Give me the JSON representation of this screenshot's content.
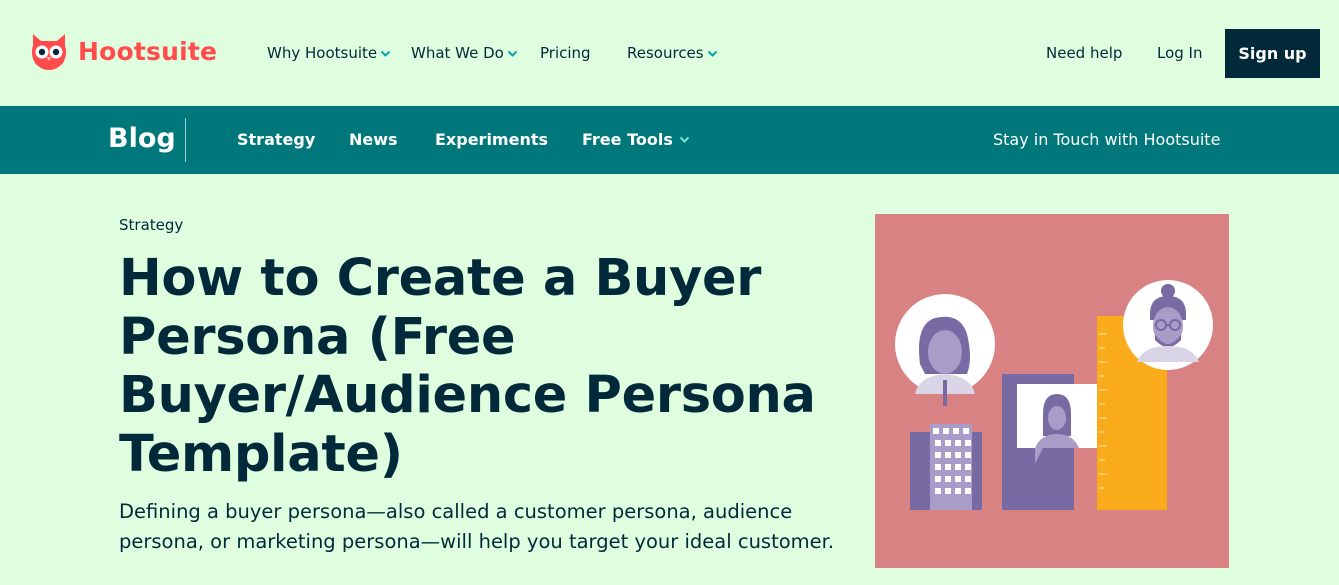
{
  "brand": {
    "name": "Hootsuite",
    "accent": "#ff4b4b",
    "dark": "#012939",
    "teal": "#00777a",
    "background": "#dffee0"
  },
  "topnav": {
    "items": [
      {
        "label": "Why Hootsuite",
        "has_dropdown": true
      },
      {
        "label": "What We Do",
        "has_dropdown": true
      },
      {
        "label": "Pricing",
        "has_dropdown": false
      },
      {
        "label": "Resources",
        "has_dropdown": true
      }
    ],
    "help": "Need help",
    "login": "Log In",
    "signup": "Sign up"
  },
  "blogbar": {
    "title": "Blog",
    "items": [
      {
        "label": "Strategy"
      },
      {
        "label": "News"
      },
      {
        "label": "Experiments"
      },
      {
        "label": "Free Tools",
        "has_dropdown": true
      }
    ],
    "stay": "Stay in Touch with Hootsuite"
  },
  "article": {
    "category": "Strategy",
    "title": "How to Create a Buyer Persona (Free Buyer/Audience Persona Template)",
    "lead": "Defining a buyer persona—also called a customer persona, audience persona, or marketing persona—will help you target your ideal customer.",
    "hero_colors": {
      "bg": "#d88284",
      "purple": "#786aa3",
      "lilac": "#a99cc9",
      "orange": "#f9ab1c"
    }
  },
  "icons": {
    "owl": "owl-logo-icon",
    "chevron": "chevron-down-icon"
  }
}
